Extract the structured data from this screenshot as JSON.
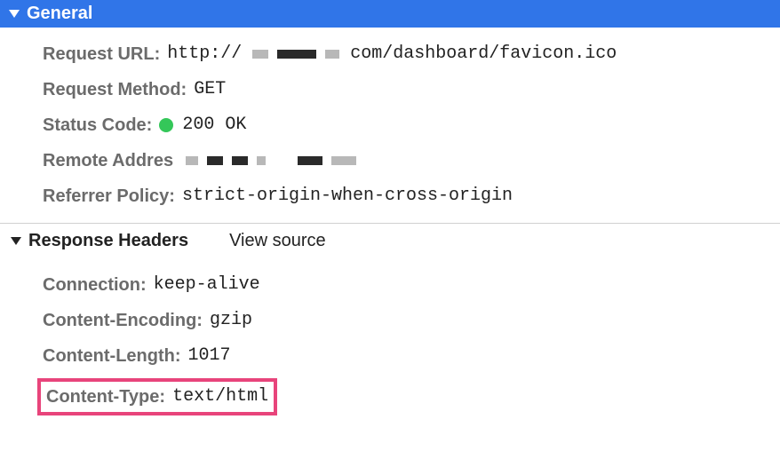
{
  "general": {
    "title": "General",
    "request_url_label": "Request URL:",
    "request_url_prefix": "http://",
    "request_url_suffix": "com/dashboard/favicon.ico",
    "request_method_label": "Request Method:",
    "request_method_value": "GET",
    "status_code_label": "Status Code:",
    "status_code_value": "200 OK",
    "remote_address_label": "Remote Addres",
    "referrer_policy_label": "Referrer Policy:",
    "referrer_policy_value": "strict-origin-when-cross-origin"
  },
  "response_headers": {
    "title": "Response Headers",
    "view_source": "View source",
    "connection_label": "Connection:",
    "connection_value": "keep-alive",
    "content_encoding_label": "Content-Encoding:",
    "content_encoding_value": "gzip",
    "content_length_label": "Content-Length:",
    "content_length_value": "1017",
    "content_type_label": "Content-Type:",
    "content_type_value": "text/html"
  }
}
